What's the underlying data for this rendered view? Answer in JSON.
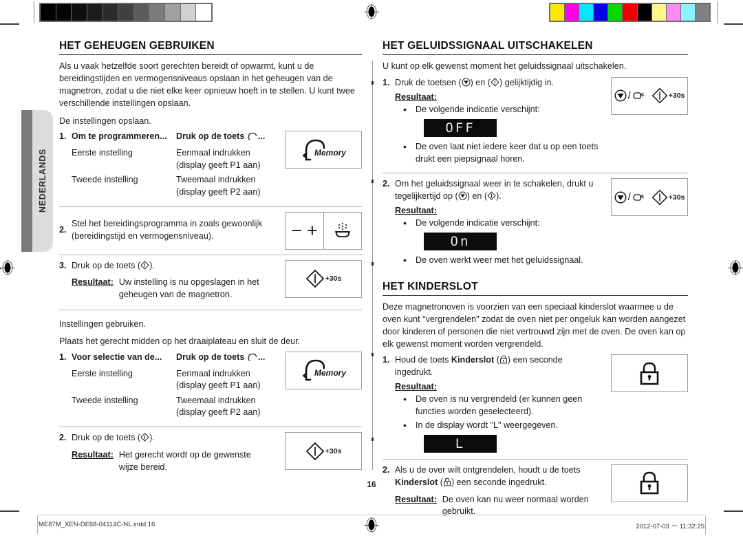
{
  "document": {
    "page_number": "16",
    "language_tab": "NEDERLANDS",
    "footer_left": "ME87M_XEN-DE68-04114C-NL.indd   16",
    "footer_right": "2012-07-03   ㄧ 11:32:25"
  },
  "calibration": {
    "grayscale_swatches": [
      "#000000",
      "#050505",
      "#0f0f0f",
      "#1c1c1c",
      "#2b2b2b",
      "#414141",
      "#5c5c5c",
      "#7b7b7b",
      "#a0a0a0",
      "#d2d2d2",
      "#ffffff"
    ],
    "color_swatches": [
      "#ffe800",
      "#ff00e8",
      "#00e8ff",
      "#0000e0",
      "#00d800",
      "#ee0000",
      "#000000",
      "#fff68a",
      "#ff8cf2",
      "#8cf2ff",
      "#808080"
    ]
  },
  "left_column": {
    "heading": "HET GEHEUGEN GEBRUIKEN",
    "intro": "Als u vaak hetzelfde soort gerechten bereidt of opwarmt, kunt u de bereidingstijden en vermogensniveaus opslaan in het geheugen van de magnetron, zodat u die niet elke keer opnieuw hoeft in te stellen. U kunt twee verschillende instellingen opslaan.",
    "save_lead": "De instellingen opslaan.",
    "save_step1": {
      "num": "1.",
      "col1_header": "Om te programmeren...",
      "col2_header": "Druk op de toets ",
      "col2_header_suffix": "...",
      "rows": [
        {
          "c1": "Eerste instelling",
          "c2": "Eenmaal indrukken (display geeft P1 aan)"
        },
        {
          "c1": "Tweede instelling",
          "c2": "Tweemaal indrukken (display geeft P2 aan)"
        }
      ],
      "icon_label": "Memory"
    },
    "save_step2": {
      "num": "2.",
      "text": "Stel het bereidingsprogramma in zoals gewoonlijk (bereidingstijd en vermogensniveau)."
    },
    "save_step3": {
      "num": "3.",
      "text_before": "Druk op de toets (",
      "text_after": ").",
      "result_label": "Resultaat:",
      "result_text": "Uw instelling is nu opgeslagen in het geheugen van de magnetron.",
      "icon_label": "+30s"
    },
    "use_lead": "Instellingen gebruiken.",
    "use_note": "Plaats het gerecht midden op het draaiplateau en sluit de deur.",
    "use_step1": {
      "num": "1.",
      "col1_header": "Voor selectie van de...",
      "col2_header": "Druk op de toets ",
      "col2_header_suffix": "...",
      "rows": [
        {
          "c1": "Eerste instelling",
          "c2": "Eenmaal indrukken (display geeft P1 aan)"
        },
        {
          "c1": "Tweede instelling",
          "c2": "Tweemaal indrukken (display geeft P2 aan)"
        }
      ],
      "icon_label": "Memory"
    },
    "use_step2": {
      "num": "2.",
      "text_before": "Druk op de toets (",
      "text_after": ").",
      "result_label": "Resultaat:",
      "result_text": "Het gerecht wordt op de gewenste wijze bereid.",
      "icon_label": "+30s"
    }
  },
  "right_column": {
    "sound": {
      "heading": "HET GELUIDSSIGNAAL UITSCHAKELEN",
      "intro": "U kunt op elk gewenst moment het geluidssignaal uitschakelen.",
      "step1": {
        "num": "1.",
        "text_a": "Druk de toetsen (",
        "text_b": ") en (",
        "text_c": ") gelijktijdig in.",
        "result_label": "Resultaat:",
        "bullet1": "De volgende indicatie verschijnt:",
        "display": "OFF",
        "bullet2": "De oven laat niet iedere keer dat u op een toets drukt een piepsignaal horen.",
        "icon_label": "+30s"
      },
      "step2": {
        "num": "2.",
        "text_a": "Om het geluidssignaal weer in te schakelen, drukt u tegelijkertijd op (",
        "text_b": ") en (",
        "text_c": ").",
        "result_label": "Resultaat:",
        "bullet1": "De volgende indicatie verschijnt:",
        "display": "On",
        "bullet2": "De oven werkt weer met het geluidssignaal.",
        "icon_label": "+30s"
      }
    },
    "childlock": {
      "heading": "HET KINDERSLOT",
      "intro": "Deze magnetronoven is voorzien van een speciaal kinderslot waarmee u de oven kunt \"vergrendelen\" zodat de oven niet per ongeluk kan worden aangezet door kinderen of personen die niet vertrouwd zijn met de oven. De oven kan op elk gewenst moment worden vergrendeld.",
      "step1": {
        "num": "1.",
        "text_a": "Houd de toets ",
        "text_bold": "Kinderslot",
        "text_b": " (",
        "text_c": ") een seconde ingedrukt.",
        "result_label": "Resultaat:",
        "bullet1": "De oven is nu vergrendeld (er kunnen geen functies worden geselecteerd).",
        "bullet2": "In de display wordt \"L\" weergegeven.",
        "display": "L"
      },
      "step2": {
        "num": "2.",
        "text_a": "Als u de over wilt ontgrendelen, houdt u de toets ",
        "text_bold": "Kinderslot",
        "text_b": " (",
        "text_c": ") een seconde ingedrukt.",
        "result_label": "Resultaat:",
        "result_text": "De oven kan nu weer normaal worden gebruikt."
      }
    }
  }
}
